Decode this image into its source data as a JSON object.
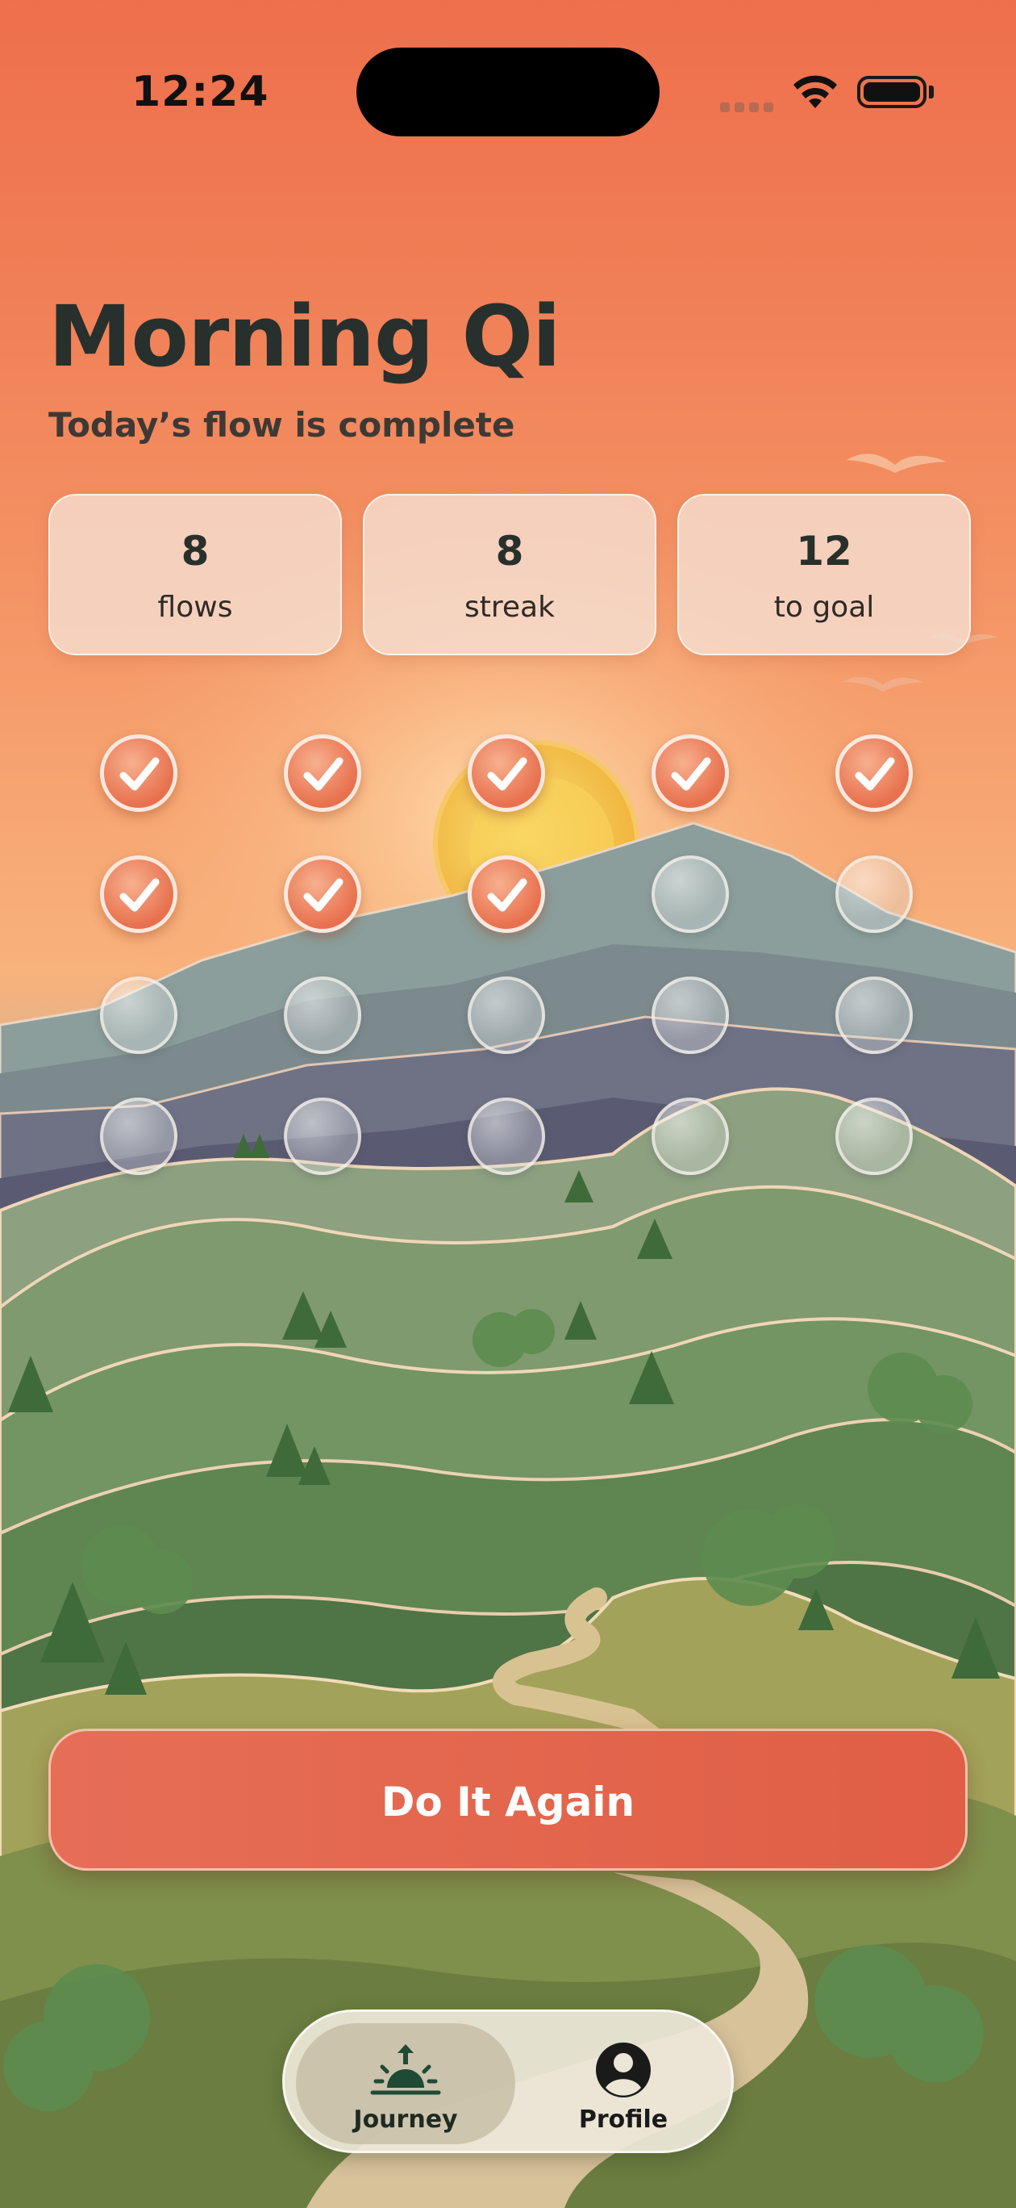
{
  "status": {
    "time": "12:24"
  },
  "header": {
    "title": "Morning Qi",
    "subtitle": "Today’s flow is complete"
  },
  "stats": [
    {
      "value": "8",
      "label": "flows"
    },
    {
      "value": "8",
      "label": "streak"
    },
    {
      "value": "12",
      "label": "to goal"
    }
  ],
  "progress": {
    "completed": 8,
    "total": 20
  },
  "cta": {
    "label": "Do It Again"
  },
  "tabbar": {
    "items": [
      {
        "label": "Journey",
        "icon": "sunrise-icon",
        "active": true
      },
      {
        "label": "Profile",
        "icon": "person-circle-icon",
        "active": false
      }
    ]
  },
  "colors": {
    "accent": "#e3644b",
    "title": "#27302c"
  }
}
